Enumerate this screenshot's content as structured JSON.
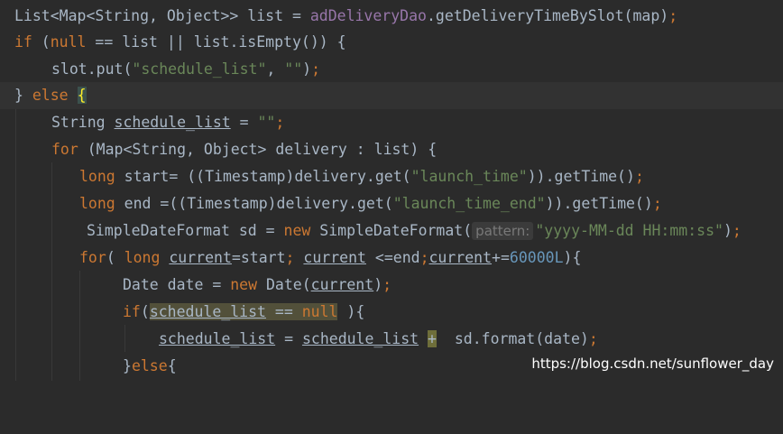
{
  "watermark": "https://blog.csdn.net/sunflower_day",
  "lines": {
    "l1": {
      "a": "List<Map<String, Object>> list = ",
      "b": "adDeliveryDao",
      "c": ".getDeliveryTimeBySlot(map)",
      "d": ";"
    },
    "l2": {
      "a": "if",
      "b": " (",
      "c": "null",
      "d": " == list || list.isEmpty()) {"
    },
    "l3": {
      "a": "slot.put(",
      "b": "\"schedule_list\"",
      "c": ", ",
      "d": "\"\"",
      "e": ")",
      "f": ";"
    },
    "l4": {
      "a": "} ",
      "b": "else",
      "c": " ",
      "d": "{"
    },
    "l5": {
      "a": "String ",
      "b": "schedule_list",
      "c": " = ",
      "d": "\"\"",
      "e": ";"
    },
    "l6": {
      "a": "for",
      "b": " (Map<String, Object> delivery : list) {"
    },
    "l7": {
      "a": "long",
      "b": " start= ((Timestamp)delivery.get(",
      "c": "\"launch_time\"",
      "d": ")).getTime()",
      "e": ";"
    },
    "l8": {
      "a": "long",
      "b": " end =((Timestamp)delivery.get(",
      "c": "\"launch_time_end\"",
      "d": ")).getTime()",
      "e": ";"
    },
    "l9": {
      "a": "SimpleDateFormat sd = ",
      "b": "new",
      "c": " SimpleDateFormat(",
      "hint": "pattern:",
      "d": "\"yyyy-MM-dd HH:mm:ss\"",
      "e": ")",
      "f": ";"
    },
    "l10": {
      "a": "for",
      "b": "( ",
      "c": "long",
      "d": " ",
      "e": "current",
      "f": "=start",
      "g": ";",
      "h": " ",
      "i": "current",
      "j": " <=end",
      "k": ";",
      "l": "current",
      "m": "+=",
      "n": "60000L",
      "o": "){"
    },
    "l11": {
      "a": "Date date = ",
      "b": "new",
      "c": " Date(",
      "d": "current",
      "e": ")",
      "f": ";"
    },
    "l12": {
      "a": "if",
      "b": "(",
      "c": "schedule_list",
      "d": " == ",
      "e": "null",
      "f": " ){"
    },
    "l13": {
      "a": "schedule_list",
      "b": " = ",
      "c": "schedule_list",
      "d": " ",
      "e": "+",
      "f": "  sd.format(date)",
      "g": ";"
    },
    "l14": {
      "a": "}",
      "b": "else",
      "c": "{"
    }
  }
}
